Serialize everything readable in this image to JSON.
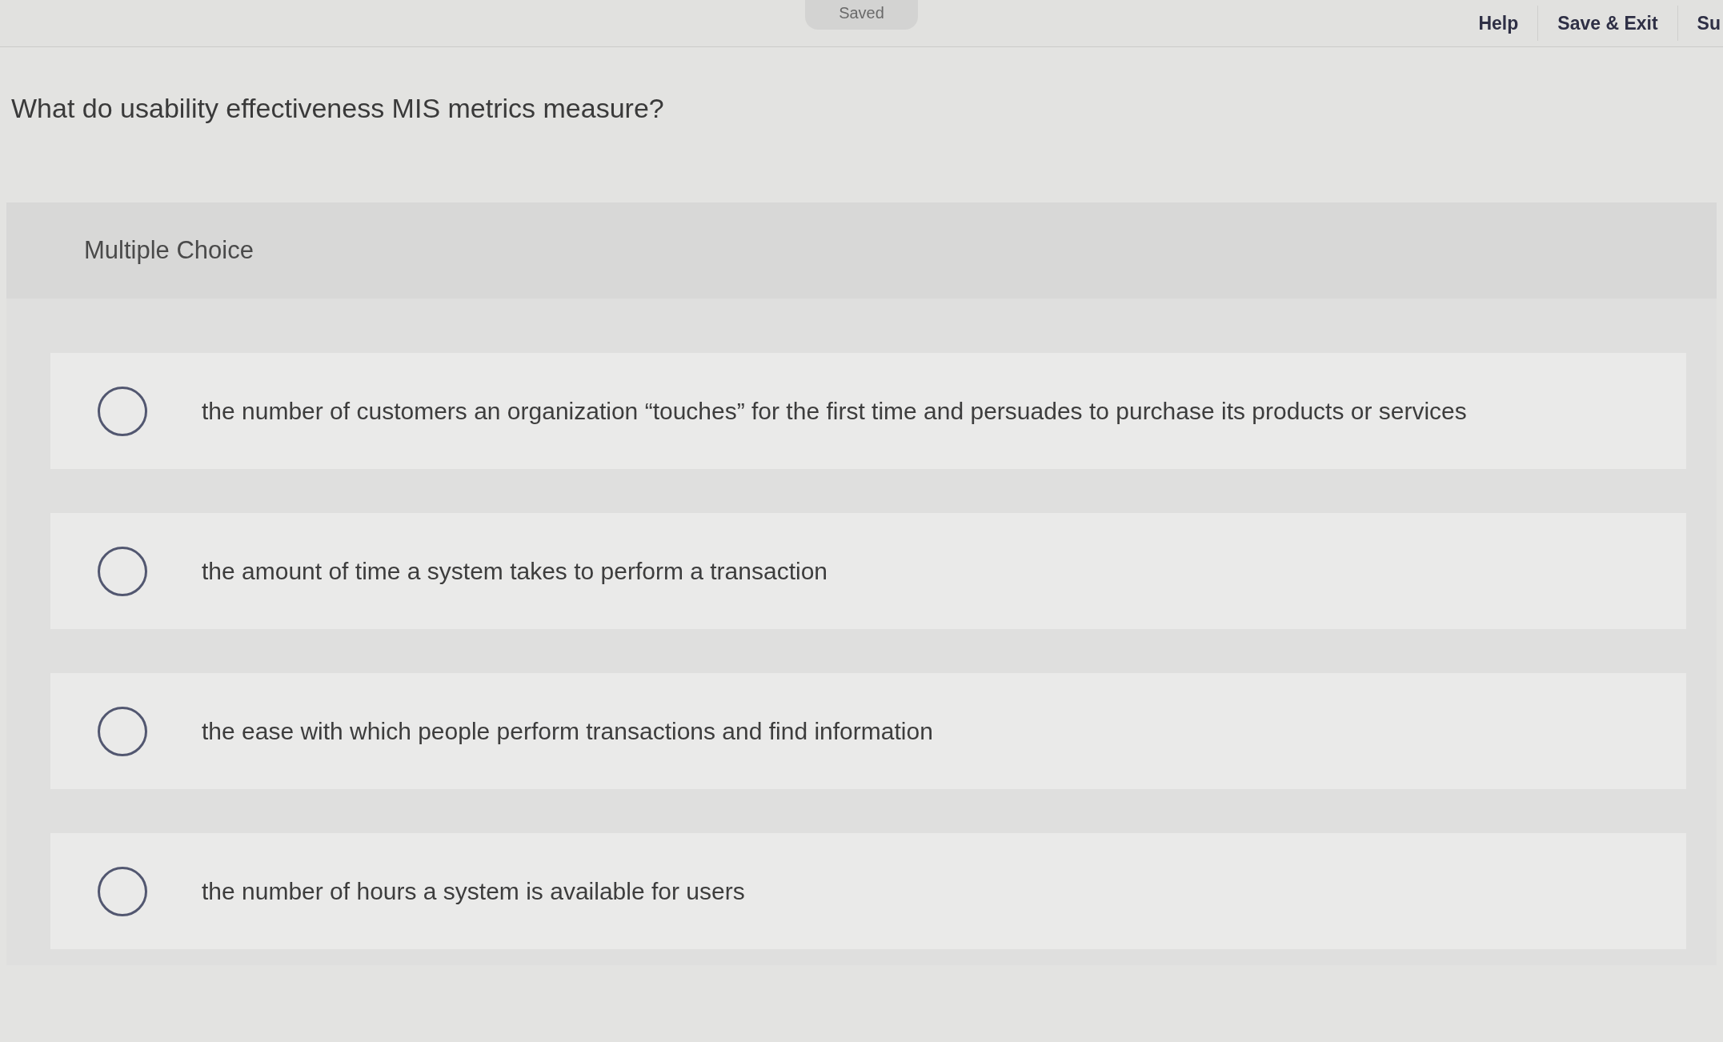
{
  "top_bar": {
    "status": "Saved",
    "links": [
      "Help",
      "Save & Exit",
      "Su"
    ]
  },
  "question": "What do usability effectiveness MIS metrics measure?",
  "answer_panel": {
    "type_label": "Multiple Choice",
    "options": [
      {
        "text": "the number of customers an organization “touches” for the first time and persuades to purchase its products or services",
        "selected": false
      },
      {
        "text": "the amount of time a system takes to perform a transaction",
        "selected": false
      },
      {
        "text": "the ease with which people perform transactions and find information",
        "selected": false
      },
      {
        "text": "the number of hours a system is available for users",
        "selected": false
      }
    ]
  }
}
